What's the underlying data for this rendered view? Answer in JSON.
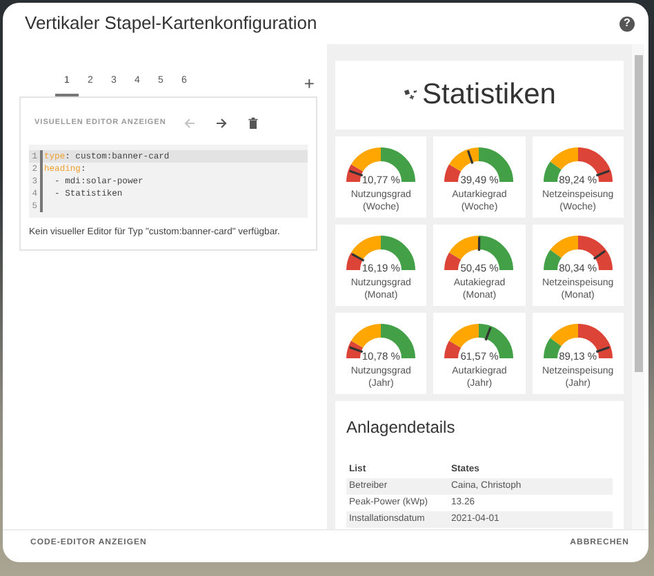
{
  "dialog": {
    "title": "Vertikaler Stapel-Kartenkonfiguration",
    "help": "?"
  },
  "editor": {
    "tabs": [
      {
        "label": "1",
        "selected": true
      },
      {
        "label": "2",
        "selected": false
      },
      {
        "label": "3",
        "selected": false
      },
      {
        "label": "4",
        "selected": false
      },
      {
        "label": "5",
        "selected": false
      },
      {
        "label": "6",
        "selected": false
      }
    ],
    "add": "+",
    "toggle": "VISUELLEN EDITOR ANZEIGEN",
    "tools": [
      {
        "kind": "back",
        "disabled": true
      },
      {
        "kind": "forward",
        "disabled": false
      },
      {
        "kind": "delete",
        "disabled": false
      }
    ],
    "code_lines": [
      {
        "number": "1",
        "key": "type",
        "text": ": custom:banner-card",
        "current": true
      },
      {
        "number": "2",
        "key": "heading",
        "text": ":",
        "current": false
      },
      {
        "number": "3",
        "text": "  - mdi:solar-power",
        "current": false
      },
      {
        "number": "4",
        "text": "  - Statistiken",
        "current": false
      },
      {
        "number": "5",
        "current": false
      }
    ],
    "message": "Kein visueller Editor für Typ \"custom:banner-card\" verfügbar."
  },
  "preview": {
    "banner": {
      "title": "Statistiken"
    },
    "gauges": [
      {
        "kind": "rising",
        "value": "10,77 %",
        "level": 0.1077,
        "label": "Nutzungsgrad",
        "period": "(Woche)"
      },
      {
        "kind": "rising",
        "value": "39,49 %",
        "level": 0.3949,
        "label": "Autarkiegrad",
        "period": "(Woche)"
      },
      {
        "kind": "falling",
        "value": "89,24 %",
        "level": 0.8924,
        "label": "Netzeinspeisung",
        "period": "(Woche)"
      },
      {
        "kind": "rising",
        "value": "16,19 %",
        "level": 0.1619,
        "label": "Nutzungsgrad",
        "period": "(Monat)"
      },
      {
        "kind": "rising",
        "value": "50,45 %",
        "level": 0.5045,
        "label": "Autakiegrad",
        "period": "(Monat)"
      },
      {
        "kind": "falling",
        "value": "80,34 %",
        "level": 0.8034,
        "label": "Netzeinspeisung",
        "period": "(Monat)"
      },
      {
        "kind": "rising",
        "value": "10,78 %",
        "level": 0.1078,
        "label": "Nutzungsgrad",
        "period": "(Jahr)"
      },
      {
        "kind": "rising",
        "value": "61,57 %",
        "level": 0.6157,
        "label": "Autarkiegrad",
        "period": "(Jahr)"
      },
      {
        "kind": "falling",
        "value": "89,13 %",
        "level": 0.8913,
        "label": "Netzeinspeisung",
        "period": "(Jahr)"
      }
    ],
    "details": {
      "title": "Anlagendetails",
      "columns": [
        "List",
        "States"
      ],
      "rows": [
        [
          "Betreiber",
          "Caina, Christoph"
        ],
        [
          "Peak-Power (kWp)",
          "13.26"
        ],
        [
          "Installationsdatum",
          "2021-04-01"
        ]
      ]
    }
  },
  "footer": {
    "left": "CODE-EDITOR ANZEIGEN",
    "right": "ABBRECHEN"
  }
}
